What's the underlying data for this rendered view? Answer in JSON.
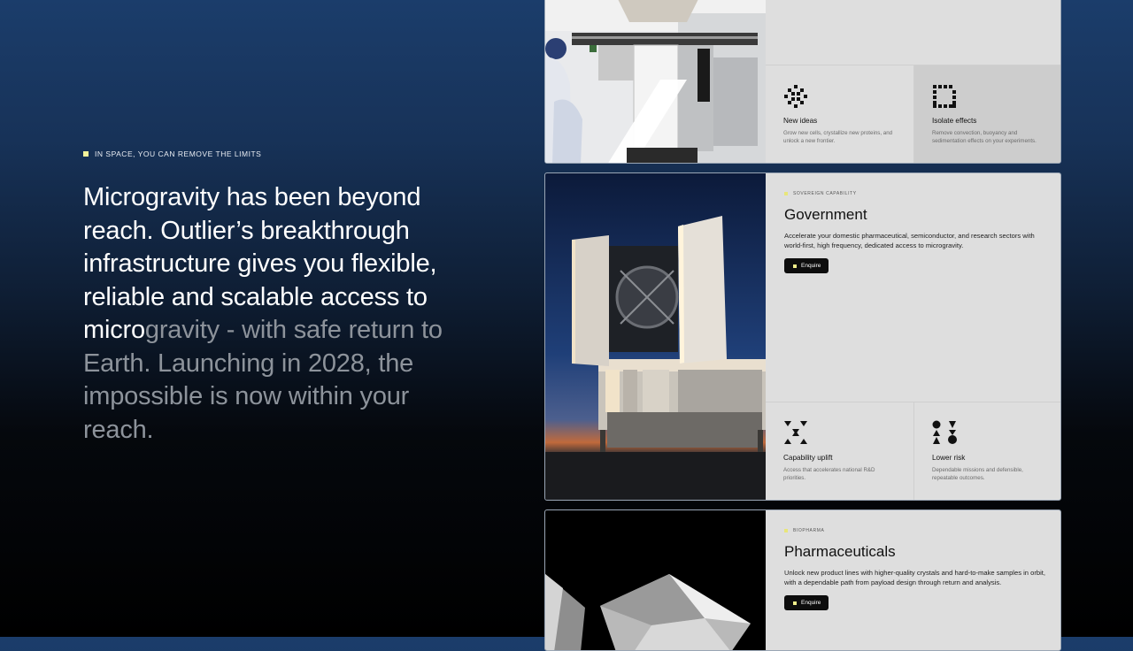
{
  "hero": {
    "eyebrow": "IN SPACE, YOU CAN REMOVE THE LIMITS",
    "lede_bright": "Microgravity has been beyond reach. Outlier’s breakthrough infrastructure gives you flexible, reliable and scalable access to micro",
    "lede_dim": "gravity - with safe return to Earth. Launching in 2028, the impossible is now within your reach."
  },
  "cards": {
    "research": {
      "features": [
        {
          "icon": "burst-dots-icon",
          "title": "New ideas",
          "desc": "Grow new cells, crystallize new proteins, and unlock a new frontier."
        },
        {
          "icon": "dotted-square-icon",
          "title": "Isolate effects",
          "desc": "Remove convection, buoyancy and sedimentation effects on your experiments."
        }
      ]
    },
    "government": {
      "tag": "SOVEREIGN CAPABILITY",
      "title": "Government",
      "desc": "Accelerate your domestic pharmaceutical, semiconductor, and research sectors with world-first, high frequency, dedicated access to microgravity.",
      "button": "Enquire",
      "features": [
        {
          "icon": "triangles-uplift-icon",
          "title": "Capability uplift",
          "desc": "Access that accelerates national R&D priorities."
        },
        {
          "icon": "shapes-risk-icon",
          "title": "Lower risk",
          "desc": "Dependable missions and defensible, repeatable outcomes."
        }
      ]
    },
    "pharma": {
      "tag": "BIOPHARMA",
      "title": "Pharmaceuticals",
      "desc": "Unlock new product lines with higher-quality crystals and hard-to-make samples in orbit, with a dependable path from payload design through return and analysis.",
      "button": "Enquire"
    }
  },
  "colors": {
    "accent": "#f3f29a",
    "card_bg": "#dedede",
    "button_bg": "#0d0d0d"
  }
}
